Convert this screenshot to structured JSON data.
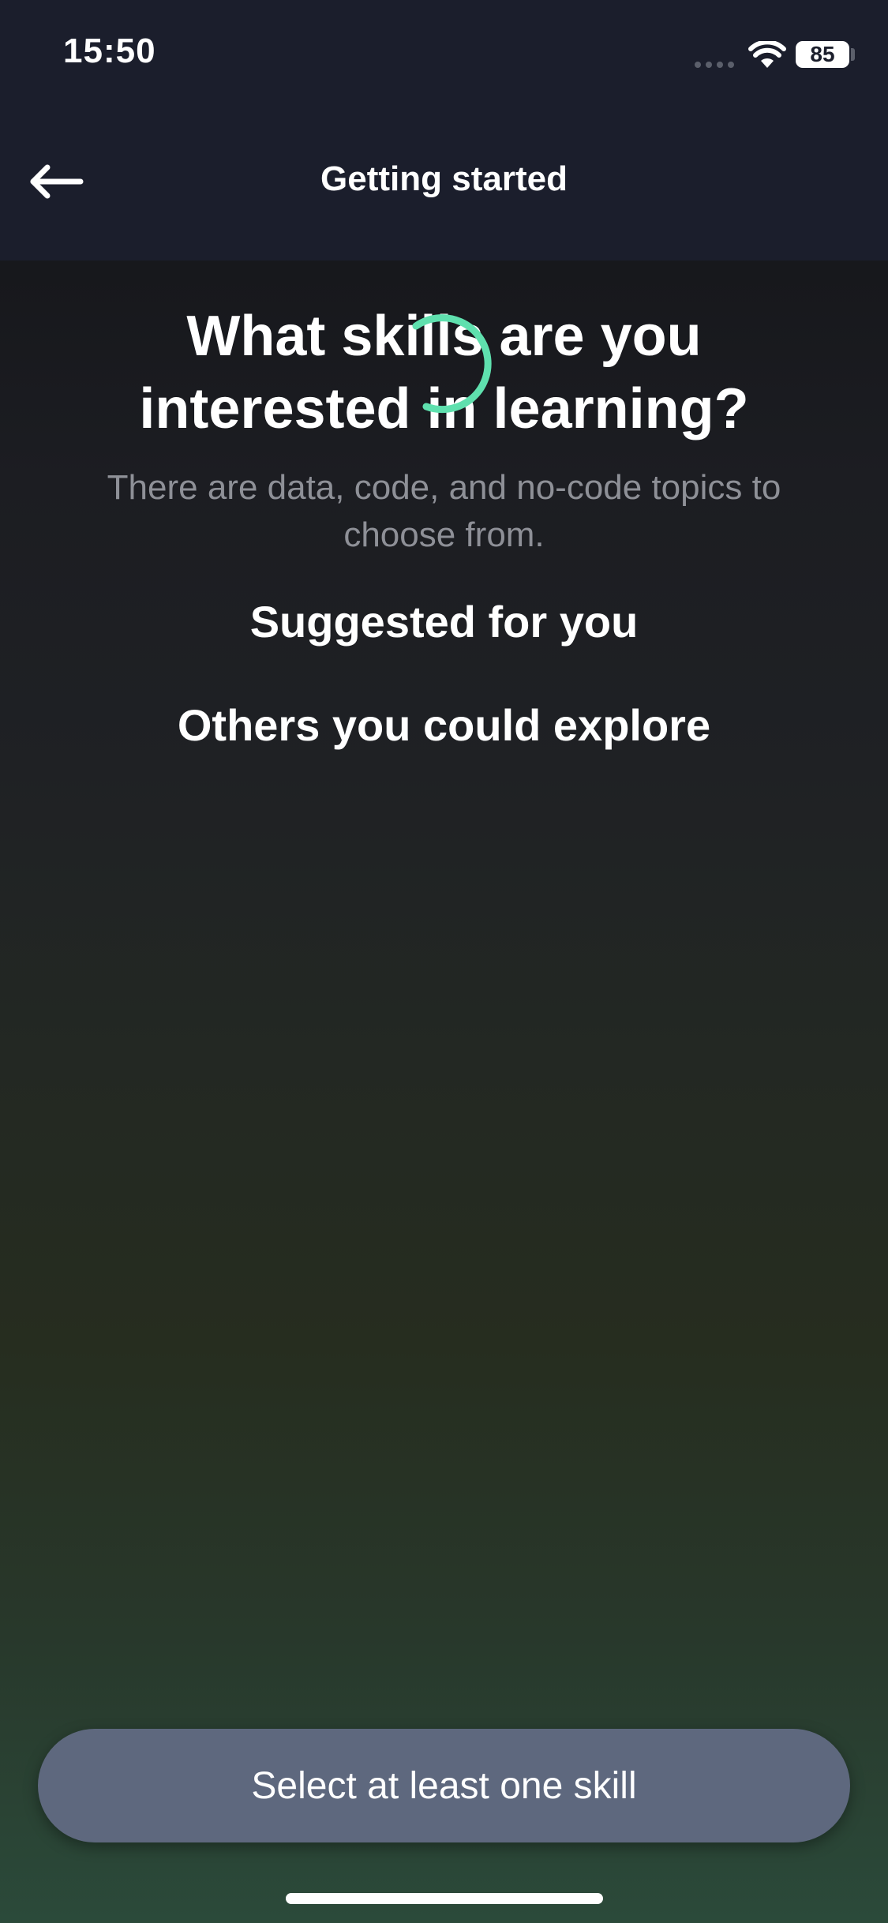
{
  "status_bar": {
    "time": "15:50",
    "battery_level": "85"
  },
  "header": {
    "title": "Getting started",
    "back_icon": "arrow-left-icon"
  },
  "main": {
    "question": "What skills are you interested in learning?",
    "subtitle": "There are data, code, and no-code topics to choose from.",
    "suggested_heading": "Suggested for you",
    "others_heading": "Others you could explore",
    "loading_icon": "spinner-icon"
  },
  "footer": {
    "cta_label": "Select at least one skill"
  },
  "colors": {
    "header_bg": "#1b1e2c",
    "spinner_accent": "#5fe0ae",
    "button_bg": "#5e687e",
    "subtitle_text": "#8e9097"
  }
}
